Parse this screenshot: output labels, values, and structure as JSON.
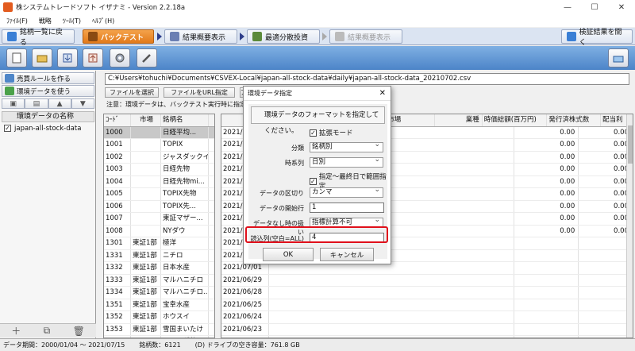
{
  "window": {
    "title": "株システムトレードソフト イザナミ - Version 2.2.18a",
    "controls": [
      "—",
      "☐",
      "✕"
    ]
  },
  "menu": [
    "ﾌｧｲﾙ(F)",
    "戦略",
    "ﾂｰﾙ(T)",
    "ﾍﾙﾌﾟ(H)"
  ],
  "tabs": {
    "back": "銘柄一覧に戻る",
    "backtest": "バックテスト",
    "summary": "結果概要表示",
    "optimize": "最適分散投資",
    "summary2": "結果概要表示",
    "open_verify": "検証結果を開く"
  },
  "left": {
    "create_rule": "売買ルールを作る",
    "use_env": "環境データを使う",
    "env_header": "環境データの名称",
    "env_items": [
      {
        "checked": "✓",
        "name": "japan-all-stock-data"
      }
    ]
  },
  "right": {
    "path": "C:¥Users¥tohuchi¥Documents¥CSVEX-Local¥japan-all-stock-data¥daily¥japan-all-stock-data_20210702.csv",
    "btn_select_file": "ファイルを選択",
    "btn_url": "ファイルをURL指定",
    "btn_a": "ア",
    "note": "注意：環境データは、バックテスト実行時に指定ファ"
  },
  "left_grid": {
    "headers": [
      "ｺｰﾄﾞ",
      "市場",
      "銘柄名"
    ],
    "rows": [
      [
        "1000",
        "",
        "日経平均..."
      ],
      [
        "1001",
        "",
        "TOPIX"
      ],
      [
        "1002",
        "",
        "ジャスダックイ..."
      ],
      [
        "1003",
        "",
        "日経先物"
      ],
      [
        "1004",
        "",
        "日経先物mi..."
      ],
      [
        "1005",
        "",
        "TOPIX先物"
      ],
      [
        "1006",
        "",
        "TOPIX先..."
      ],
      [
        "1007",
        "",
        "東証マザー..."
      ],
      [
        "1008",
        "",
        "NYダウ"
      ],
      [
        "1301",
        "東証1部",
        "極洋"
      ],
      [
        "1331",
        "東証1部",
        "ニチロ"
      ],
      [
        "1332",
        "東証1部",
        "日本水産"
      ],
      [
        "1333",
        "東証1部",
        "マルハニチロ"
      ],
      [
        "1334",
        "東証1部",
        "マルハニチロ..."
      ],
      [
        "1351",
        "東証1部",
        "宝幸水産"
      ],
      [
        "1352",
        "東証1部",
        "ホウスイ"
      ],
      [
        "1353",
        "東証1部",
        "雪国まいたけ"
      ],
      [
        "1376",
        "JASDAQ",
        "カネコ種苗"
      ]
    ]
  },
  "right_grid": {
    "headers": [
      "",
      "",
      "",
      "市場",
      "業種",
      "時価総額(百万円)",
      "発行済株式数",
      "配当利"
    ],
    "rows": [
      [
        "2021/07/01",
        "0.00",
        "0.00"
      ],
      [
        "2021/07/01",
        "0.00",
        "0.00"
      ],
      [
        "2021/07/01",
        "0.00",
        "0.00"
      ],
      [
        "2021/07/01",
        "0.00",
        "0.00"
      ],
      [
        "2021/07/01",
        "0.00",
        "0.00"
      ],
      [
        "2021/07/01",
        "0.00",
        "0.00"
      ],
      [
        "2021/07/01",
        "0.00",
        "0.00"
      ],
      [
        "2021/07/01",
        "0.00",
        "0.00"
      ],
      [
        "2021/07/01",
        "0.00",
        "0.00"
      ],
      [
        "2021/07/01",
        "",
        ""
      ],
      [
        "2021/07/01",
        "",
        ""
      ],
      [
        "2021/07/01",
        "",
        ""
      ],
      [
        "2021/06/29",
        "",
        ""
      ],
      [
        "2021/06/28",
        "",
        ""
      ],
      [
        "2021/06/25",
        "",
        ""
      ],
      [
        "2021/06/24",
        "",
        ""
      ],
      [
        "2021/06/23",
        "",
        ""
      ],
      [
        "",
        "",
        ""
      ]
    ]
  },
  "dialog": {
    "title": "環境データ指定",
    "close": "✕",
    "message": "環境データのフォーマットを指定してください。",
    "chk_extend": "拡張モード",
    "label_category": "分類",
    "val_category": "銘柄別",
    "label_timeseries": "時系列",
    "val_timeseries": "日別",
    "chk_range": "指定〜最終日で範囲指定",
    "label_delim": "データの区切り",
    "val_delim": "カンマ",
    "label_start_row": "データの開始行",
    "val_start_row": "1",
    "label_missing": "データなし時の扱い",
    "val_missing": "指標計算不可",
    "label_read_cols": "読込列(空白=ALL)",
    "val_read_cols": "4",
    "ok": "OK",
    "cancel": "キャンセル"
  },
  "status": {
    "period": "データ期間：2000/01/04 〜 2021/07/15",
    "count": "銘柄数：6121",
    "disk": "(D) ドライブの空き容量：761.8 GB"
  },
  "colors": {
    "accent_orange": "#e27a1a",
    "toolbar_blue": "#4c84c8",
    "highlight_red": "#e0101b"
  }
}
